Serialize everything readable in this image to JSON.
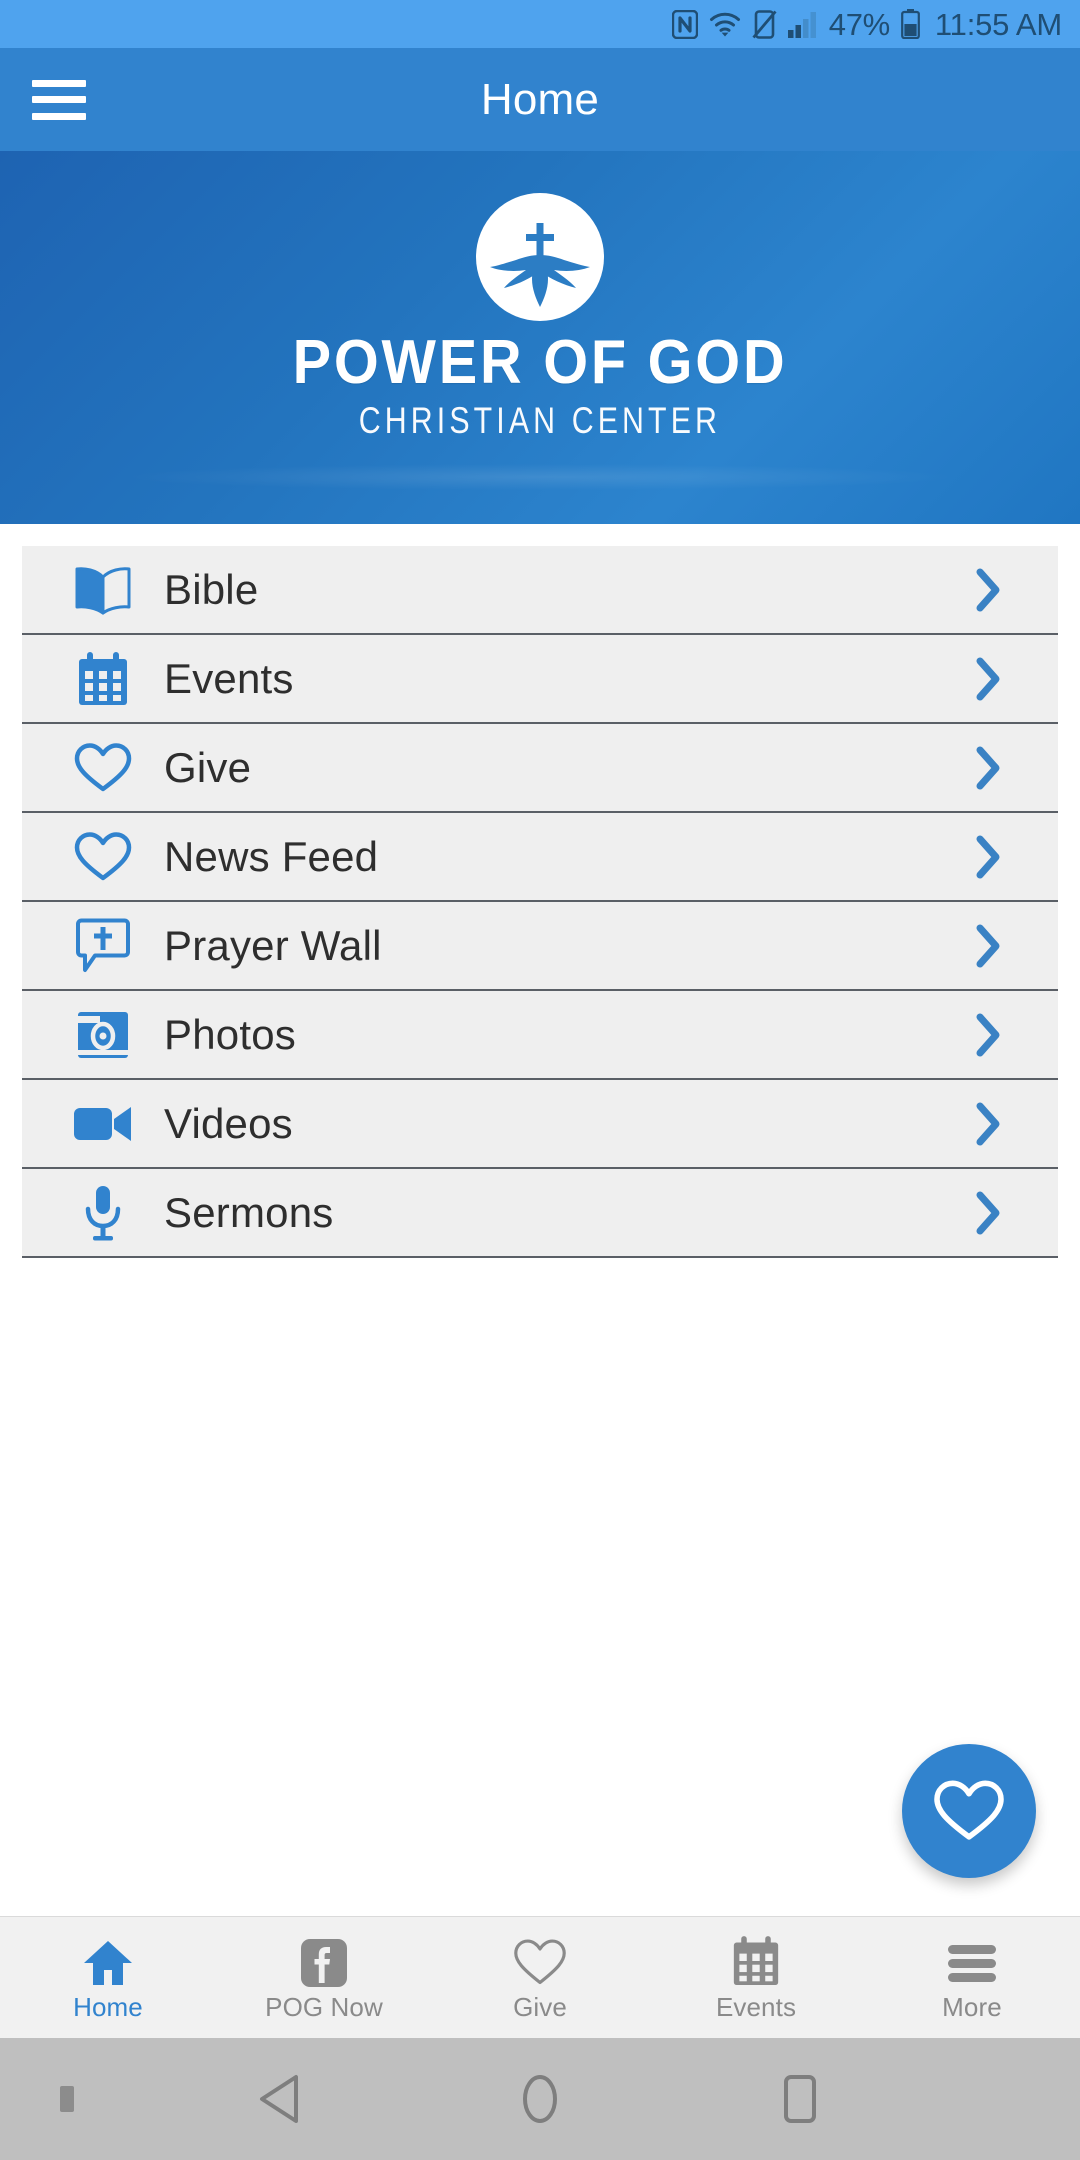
{
  "status_bar": {
    "nfc_icon": "nfc-icon",
    "wifi_icon": "wifi-icon",
    "vibrate_icon": "vibrate-mode-icon",
    "signal_icon": "cellular-signal-icon",
    "battery_percent": "47%",
    "battery_icon": "battery-icon",
    "clock": "11:55 AM",
    "background_color": "#4FA3EE",
    "text_color": "#1F4E74"
  },
  "app_bar": {
    "menu_icon": "hamburger-menu-icon",
    "title": "Home",
    "background_color": "#3183CE"
  },
  "banner": {
    "logo_icon": "church-dove-cross-logo",
    "title": "POWER OF GOD",
    "subtitle": "CHRISTIAN CENTER",
    "gradient_from": "#1E63B2",
    "gradient_to": "#2C84CE"
  },
  "menu": {
    "accent_color": "#3183CE",
    "row_background": "#EFEFEF",
    "items": [
      {
        "label": "Bible",
        "icon": "open-book-icon",
        "chevron": "chevron-right-icon"
      },
      {
        "label": "Events",
        "icon": "calendar-icon",
        "chevron": "chevron-right-icon"
      },
      {
        "label": "Give",
        "icon": "heart-outline-icon",
        "chevron": "chevron-right-icon"
      },
      {
        "label": "News Feed",
        "icon": "heart-outline-icon",
        "chevron": "chevron-right-icon"
      },
      {
        "label": "Prayer Wall",
        "icon": "speech-bubble-cross-icon",
        "chevron": "chevron-right-icon"
      },
      {
        "label": "Photos",
        "icon": "camera-icon",
        "chevron": "chevron-right-icon"
      },
      {
        "label": "Videos",
        "icon": "video-camera-icon",
        "chevron": "chevron-right-icon"
      },
      {
        "label": "Sermons",
        "icon": "microphone-icon",
        "chevron": "chevron-right-icon"
      }
    ]
  },
  "fab": {
    "icon": "heart-outline-icon",
    "background_color": "#3183CE"
  },
  "tab_bar": {
    "active_color": "#3183CE",
    "inactive_color": "#8A8A8A",
    "tabs": [
      {
        "label": "Home",
        "icon": "home-icon",
        "active": true
      },
      {
        "label": "POG Now",
        "icon": "facebook-icon",
        "active": false
      },
      {
        "label": "Give",
        "icon": "heart-outline-icon",
        "active": false
      },
      {
        "label": "Events",
        "icon": "calendar-icon",
        "active": false
      },
      {
        "label": "More",
        "icon": "hamburger-menu-icon",
        "active": false
      }
    ]
  },
  "android_nav": {
    "keyboard_indicator": "keyboard-indicator-dot",
    "back": "back-triangle-icon",
    "home": "home-circle-icon",
    "recents": "recents-square-icon",
    "background_color": "#BFBFBF"
  }
}
